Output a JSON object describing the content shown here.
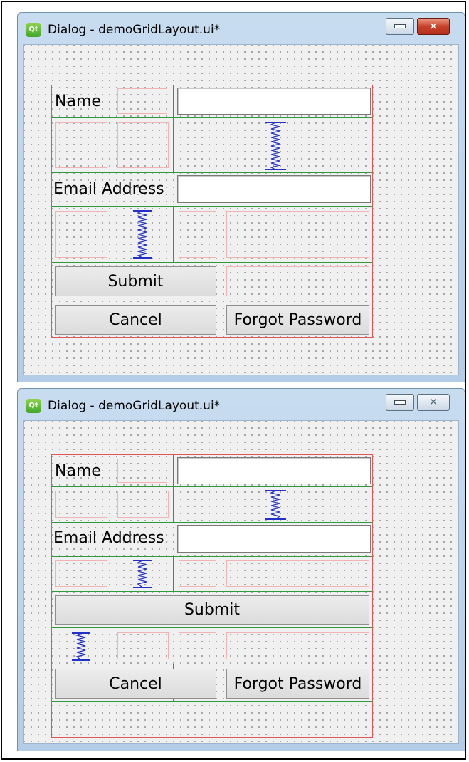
{
  "windows": [
    {
      "title": "Dialog - demoGridLayout.ui*",
      "close_style": "active-red",
      "fields": {
        "name_label": "Name",
        "email_label": "Email Address",
        "name_value": "",
        "email_value": ""
      },
      "buttons": {
        "submit": "Submit",
        "cancel": "Cancel",
        "forgot": "Forgot Password"
      }
    },
    {
      "title": "Dialog - demoGridLayout.ui*",
      "close_style": "inactive",
      "fields": {
        "name_label": "Name",
        "email_label": "Email Address",
        "name_value": "",
        "email_value": ""
      },
      "buttons": {
        "submit": "Submit",
        "cancel": "Cancel",
        "forgot": "Forgot Password"
      }
    }
  ],
  "icons": {
    "app": "qt-app-icon",
    "minimize": "minimize-icon",
    "close": "close-icon",
    "spacer": "vertical-spacer-icon"
  },
  "colors": {
    "layout_border": "#e05555",
    "grid_line": "#2e9a3c",
    "spacer": "#2030c8",
    "close_active": "#c8422b"
  }
}
